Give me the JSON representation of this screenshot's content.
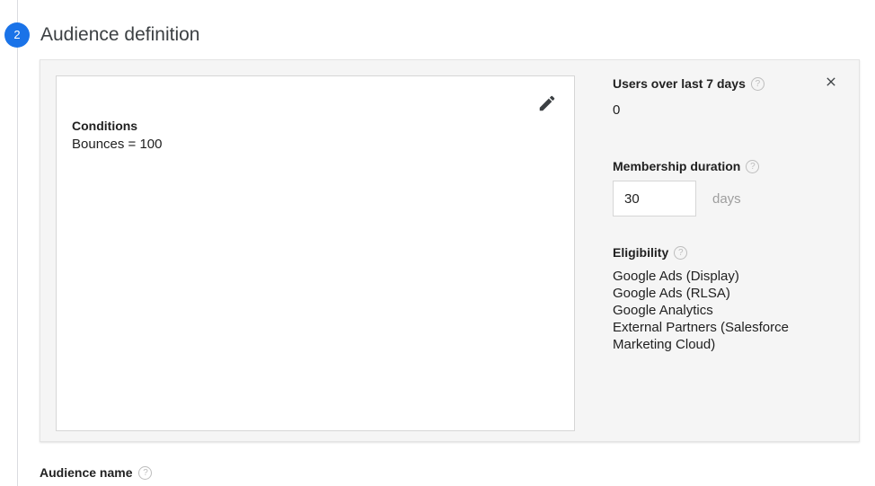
{
  "stepper": {
    "step_number": "2"
  },
  "section": {
    "title": "Audience definition"
  },
  "conditions_panel": {
    "heading": "Conditions",
    "value": "Bounces = 100",
    "edit_icon": "pencil-icon"
  },
  "details": {
    "users": {
      "heading": "Users over last 7 days",
      "help": "?",
      "value": "0"
    },
    "close_icon": "close-icon",
    "membership": {
      "heading": "Membership duration",
      "help": "?",
      "duration_value": "30",
      "duration_placeholder": "30",
      "unit_label": "days"
    },
    "eligibility": {
      "heading": "Eligibility",
      "help": "?",
      "items": [
        "Google Ads (Display)",
        "Google Ads (RLSA)",
        "Google Analytics",
        "External Partners (Salesforce\nMarketing Cloud)"
      ]
    }
  },
  "footer": {
    "audience_name_label": "Audience name",
    "audience_name_help": "?"
  },
  "colors": {
    "accent": "#1a73e8",
    "card_background": "#f5f5f5",
    "panel_background": "#ffffff",
    "text_primary": "#212121",
    "text_muted": "#9e9e9e",
    "border": "#d6d6d6"
  }
}
